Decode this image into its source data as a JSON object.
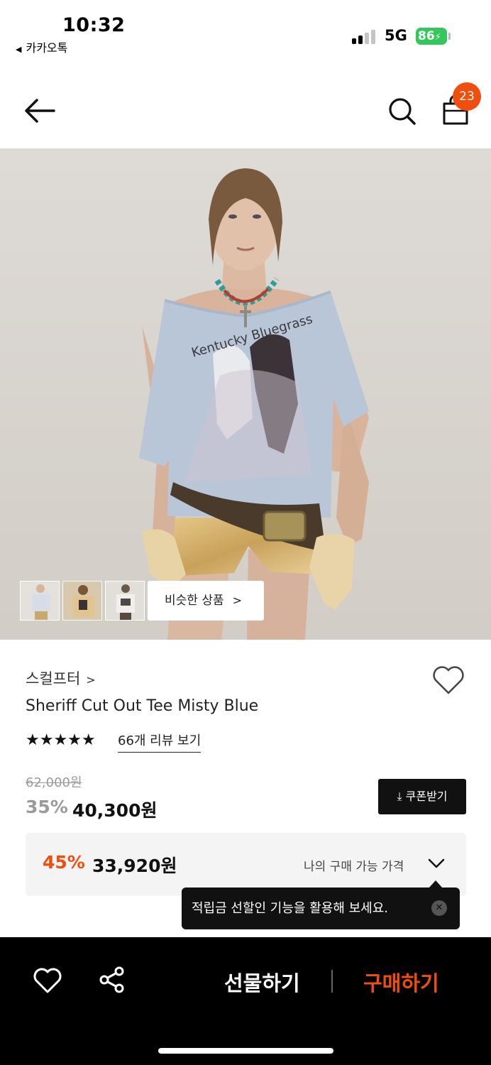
{
  "status": {
    "time": "10:32",
    "back_app": "카카오톡",
    "network": "5G",
    "battery": "86"
  },
  "header": {
    "cart_count": "23"
  },
  "gallery": {
    "print_text": "Kentucky Bluegrass",
    "similar_label": "비슷한 상품"
  },
  "product": {
    "brand": "스컬프터",
    "name": "Sheriff Cut Out Tee Misty Blue",
    "rating": 5,
    "stars": "★★★★★",
    "review_link": "66개 리뷰 보기",
    "original_price": "62,000원",
    "discount_rate": "35%",
    "sale_price": "40,300원",
    "coupon_label": "쿠폰받기"
  },
  "my_price": {
    "rate": "45%",
    "amount": "33,920원",
    "label": "나의 구매 가능 가격"
  },
  "tooltip": {
    "text": "적립금 선할인 기능을 활용해 보세요."
  },
  "bottom_bar": {
    "gift_label": "선물하기",
    "buy_label": "구매하기"
  },
  "colors": {
    "accent": "#f04e0c",
    "battery": "#34c759",
    "dark": "#111111"
  }
}
